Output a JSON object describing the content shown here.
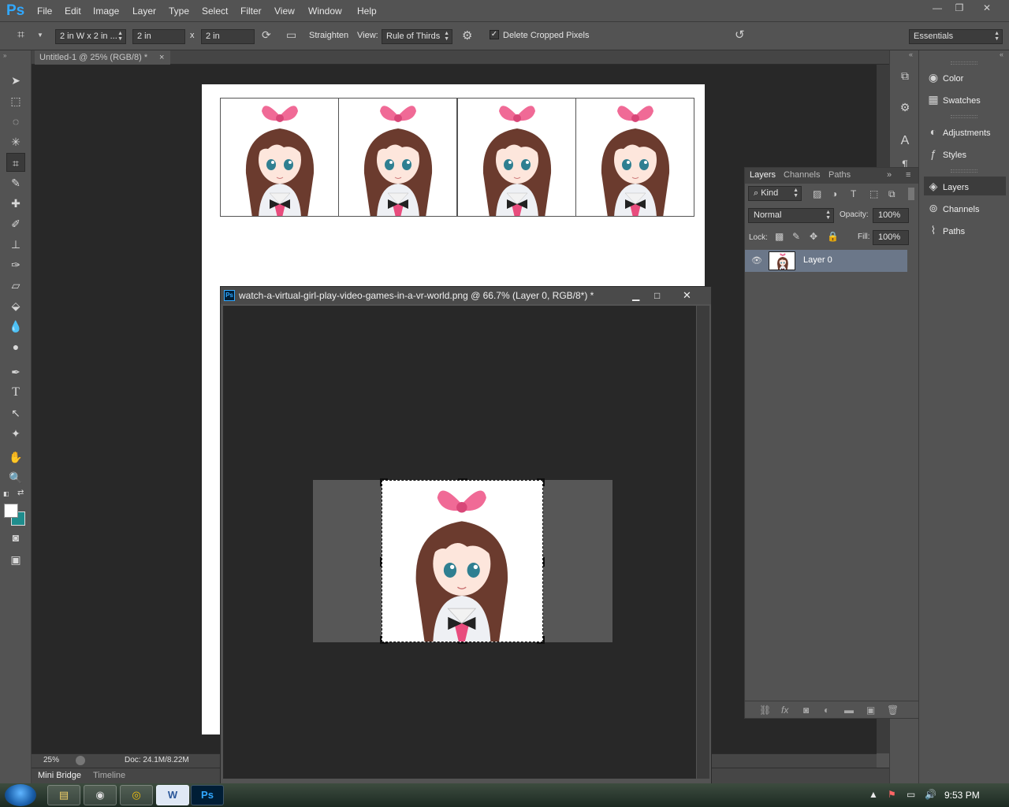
{
  "app": {
    "logo": "Ps"
  },
  "menu": [
    "File",
    "Edit",
    "Image",
    "Layer",
    "Type",
    "Select",
    "Filter",
    "View",
    "Window",
    "Help"
  ],
  "window_controls": {
    "minimize": "—",
    "restore": "❐",
    "close": "✕"
  },
  "options": {
    "preset": "2 in W x 2 in ...",
    "width": "2 in",
    "x_sep": "x",
    "height": "2 in",
    "straighten": "Straighten",
    "view_label": "View:",
    "view_value": "Rule of Thirds",
    "delete_cropped": "Delete Cropped Pixels",
    "delete_cropped_checked": true,
    "workspace": "Essentials"
  },
  "document": {
    "tab": "Untitled-1 @ 25% (RGB/8) *",
    "tab_close": "×",
    "zoom": "25%",
    "doc_info": "Doc: 24.1M/8.22M"
  },
  "bottom_tabs": [
    "Mini Bridge",
    "Timeline"
  ],
  "float_window": {
    "icon": "Ps",
    "title": "watch-a-virtual-girl-play-video-games-in-a-vr-world.png @ 66.7% (Layer 0, RGB/8*) *"
  },
  "dock": {
    "items": [
      {
        "label": "Color",
        "icon": "color-icon"
      },
      {
        "label": "Swatches",
        "icon": "swatches-icon"
      },
      {
        "label": "Adjustments",
        "icon": "adjustments-icon"
      },
      {
        "label": "Styles",
        "icon": "styles-icon"
      },
      {
        "label": "Layers",
        "icon": "layers-icon"
      },
      {
        "label": "Channels",
        "icon": "channels-icon"
      },
      {
        "label": "Paths",
        "icon": "paths-icon"
      }
    ]
  },
  "layers_panel": {
    "tabs": [
      "Layers",
      "Channels",
      "Paths"
    ],
    "filter": "Kind",
    "blend_mode": "Normal",
    "opacity_label": "Opacity:",
    "opacity": "100%",
    "lock_label": "Lock:",
    "fill_label": "Fill:",
    "fill": "100%",
    "layer_name": "Layer 0"
  },
  "taskbar": {
    "clock": "9:53 PM"
  },
  "colors": {
    "accent": "#31a8ff",
    "selection": "#6b7789",
    "bg": "#535353",
    "canvas": "#282828"
  }
}
